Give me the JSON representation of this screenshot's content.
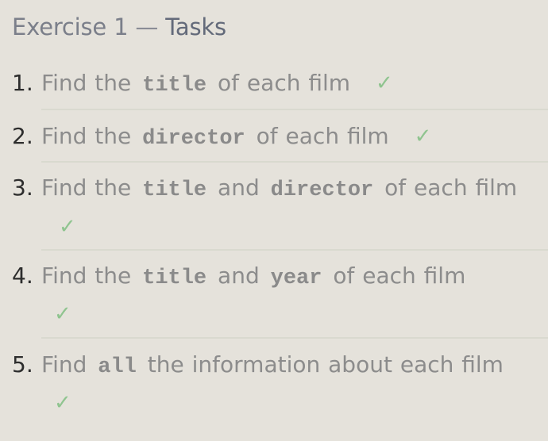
{
  "header": {
    "prefix": "Exercise 1",
    "dash": "—",
    "suffix": "Tasks"
  },
  "tasks": [
    {
      "number": "1.",
      "parts": [
        {
          "type": "text",
          "value": "Find the "
        },
        {
          "type": "code",
          "value": "title"
        },
        {
          "type": "text",
          "value": " of each film"
        }
      ],
      "check": "✓"
    },
    {
      "number": "2.",
      "parts": [
        {
          "type": "text",
          "value": "Find the "
        },
        {
          "type": "code",
          "value": "director"
        },
        {
          "type": "text",
          "value": " of each film"
        }
      ],
      "check": "✓"
    },
    {
      "number": "3.",
      "parts": [
        {
          "type": "text",
          "value": "Find the "
        },
        {
          "type": "code",
          "value": "title"
        },
        {
          "type": "text",
          "value": " and "
        },
        {
          "type": "code",
          "value": "director"
        },
        {
          "type": "text",
          "value": " of each film"
        }
      ],
      "check": "✓"
    },
    {
      "number": "4.",
      "parts": [
        {
          "type": "text",
          "value": "Find the "
        },
        {
          "type": "code",
          "value": "title"
        },
        {
          "type": "text",
          "value": " and "
        },
        {
          "type": "code",
          "value": "year"
        },
        {
          "type": "text",
          "value": " of each film"
        }
      ],
      "check": "✓"
    },
    {
      "number": "5.",
      "parts": [
        {
          "type": "text",
          "value": "Find "
        },
        {
          "type": "code",
          "value": "all"
        },
        {
          "type": "text",
          "value": " the information about each film"
        }
      ],
      "check": "✓"
    }
  ],
  "colors": {
    "background": "#e5e2db",
    "check": "#8fc48f",
    "number": "#2d2d2d",
    "text": "#8c8c8c",
    "title": "#636a7a"
  }
}
